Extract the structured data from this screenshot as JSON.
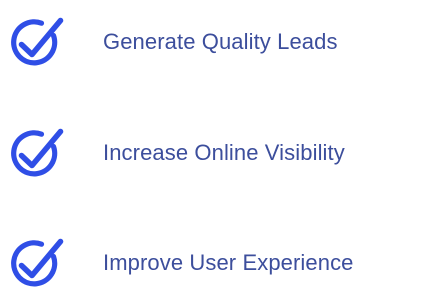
{
  "colors": {
    "accent": "#2f4ee6",
    "text": "#3c4e9c",
    "background": "#ffffff"
  },
  "icon": "check-circle-icon",
  "benefits": [
    {
      "label": "Generate Quality Leads"
    },
    {
      "label": "Increase Online Visibility"
    },
    {
      "label": "Improve User Experience"
    }
  ]
}
